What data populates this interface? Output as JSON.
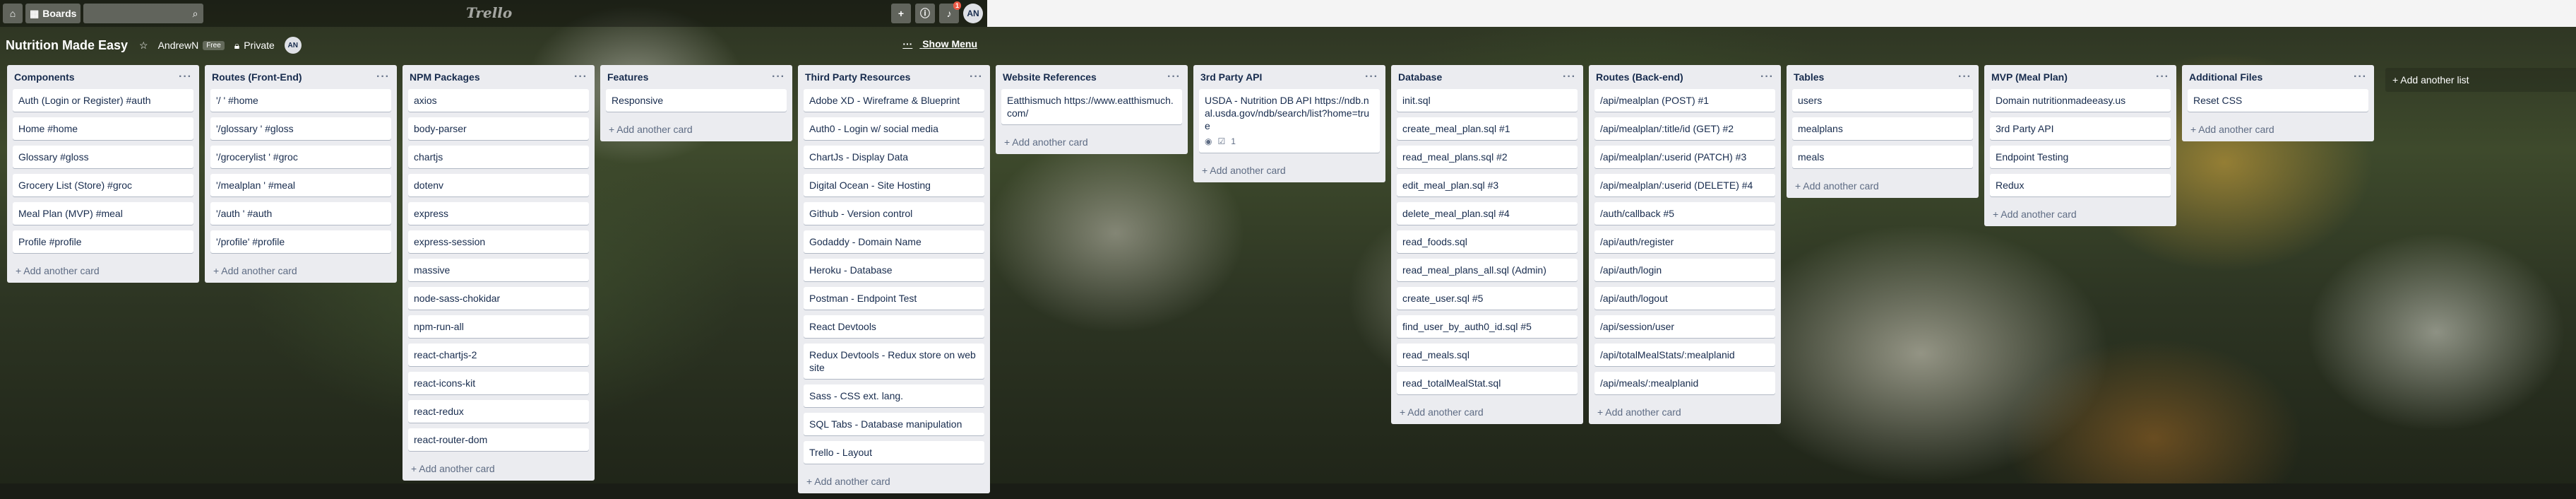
{
  "header": {
    "home_icon": "home-icon",
    "boards_label": "Boards",
    "search_icon": "search-icon",
    "logo": "Trello",
    "add_icon": "+",
    "info_icon": "info-icon",
    "notifications_count": "1",
    "user_initials": "AN"
  },
  "board": {
    "title": "Nutrition Made Easy",
    "team": "AndrewN",
    "team_badge": "Free",
    "visibility": "Private",
    "member_initials": "AN",
    "show_menu": "Show Menu"
  },
  "lists": [
    {
      "title": "Components",
      "cards": [
        "Auth (Login or Register) #auth",
        "Home #home",
        "Glossary #gloss",
        "Grocery List (Store) #groc",
        "Meal Plan (MVP) #meal",
        "Profile #profile"
      ],
      "add": "+ Add another card"
    },
    {
      "title": "Routes (Front-End)",
      "cards": [
        "'/ ' #home",
        "'/glossary ' #gloss",
        "'/grocerylist ' #groc",
        "'/mealplan ' #meal",
        "'/auth ' #auth",
        "'/profile' #profile"
      ],
      "add": "+ Add another card"
    },
    {
      "title": "NPM Packages",
      "cards": [
        "axios",
        "body-parser",
        "chartjs",
        "dotenv",
        "express",
        "express-session",
        "massive",
        "node-sass-chokidar",
        "npm-run-all",
        "react-chartjs-2",
        "react-icons-kit",
        "react-redux",
        "react-router-dom"
      ],
      "add": "+ Add another card"
    },
    {
      "title": "Features",
      "cards": [
        "Responsive"
      ],
      "add": "+ Add another card"
    },
    {
      "title": "Third Party Resources",
      "cards": [
        "Adobe XD - Wireframe & Blueprint",
        "Auth0 - Login w/ social media",
        "ChartJs - Display Data",
        "Digital Ocean - Site Hosting",
        "Github - Version control",
        "Godaddy - Domain Name",
        "Heroku - Database",
        "Postman - Endpoint Test",
        "React Devtools",
        "Redux Devtools - Redux store on website",
        "Sass - CSS ext. lang.",
        "SQL Tabs - Database manipulation",
        "Trello - Layout"
      ],
      "add": "+ Add another card"
    },
    {
      "title": "Website References",
      "cards": [
        "Eatthismuch https://www.eatthismuch.com/"
      ],
      "add": "+ Add another card"
    },
    {
      "title": "3rd Party API",
      "cards": [
        "USDA - Nutrition DB API https://ndb.nal.usda.gov/ndb/search/list?home=true"
      ],
      "card_badge": {
        "watch_icon": "eye-icon",
        "checklist_icon": "check-icon",
        "count": "1"
      },
      "add": "+ Add another card"
    },
    {
      "title": "Database",
      "cards": [
        "init.sql",
        "create_meal_plan.sql #1",
        "read_meal_plans.sql #2",
        "edit_meal_plan.sql #3",
        "delete_meal_plan.sql #4",
        "read_foods.sql",
        "read_meal_plans_all.sql (Admin)",
        "create_user.sql #5",
        "find_user_by_auth0_id.sql #5",
        "read_meals.sql",
        "read_totalMealStat.sql"
      ],
      "add": "+ Add another card"
    },
    {
      "title": "Routes (Back-end)",
      "cards": [
        "/api/mealplan (POST) #1",
        "/api/mealplan/:title/id (GET) #2",
        "/api/mealplan/:userid (PATCH) #3",
        "/api/mealplan/:userid (DELETE) #4",
        "/auth/callback #5",
        "/api/auth/register",
        "/api/auth/login",
        "/api/auth/logout",
        "/api/session/user",
        "/api/totalMealStats/:mealplanid",
        "/api/meals/:mealplanid"
      ],
      "add": "+ Add another card"
    },
    {
      "title": "Tables",
      "cards": [
        "users",
        "mealplans",
        "meals"
      ],
      "add": "+ Add another card"
    },
    {
      "title": "MVP (Meal Plan)",
      "cards": [
        "Domain nutritionmadeeasy.us",
        "3rd Party API",
        "Endpoint Testing",
        "Redux"
      ],
      "add": "+ Add another card"
    },
    {
      "title": "Additional Files",
      "cards": [
        "Reset CSS"
      ],
      "add": "+ Add another card"
    }
  ],
  "add_list": "+ Add another list",
  "menu_glyph": "···"
}
